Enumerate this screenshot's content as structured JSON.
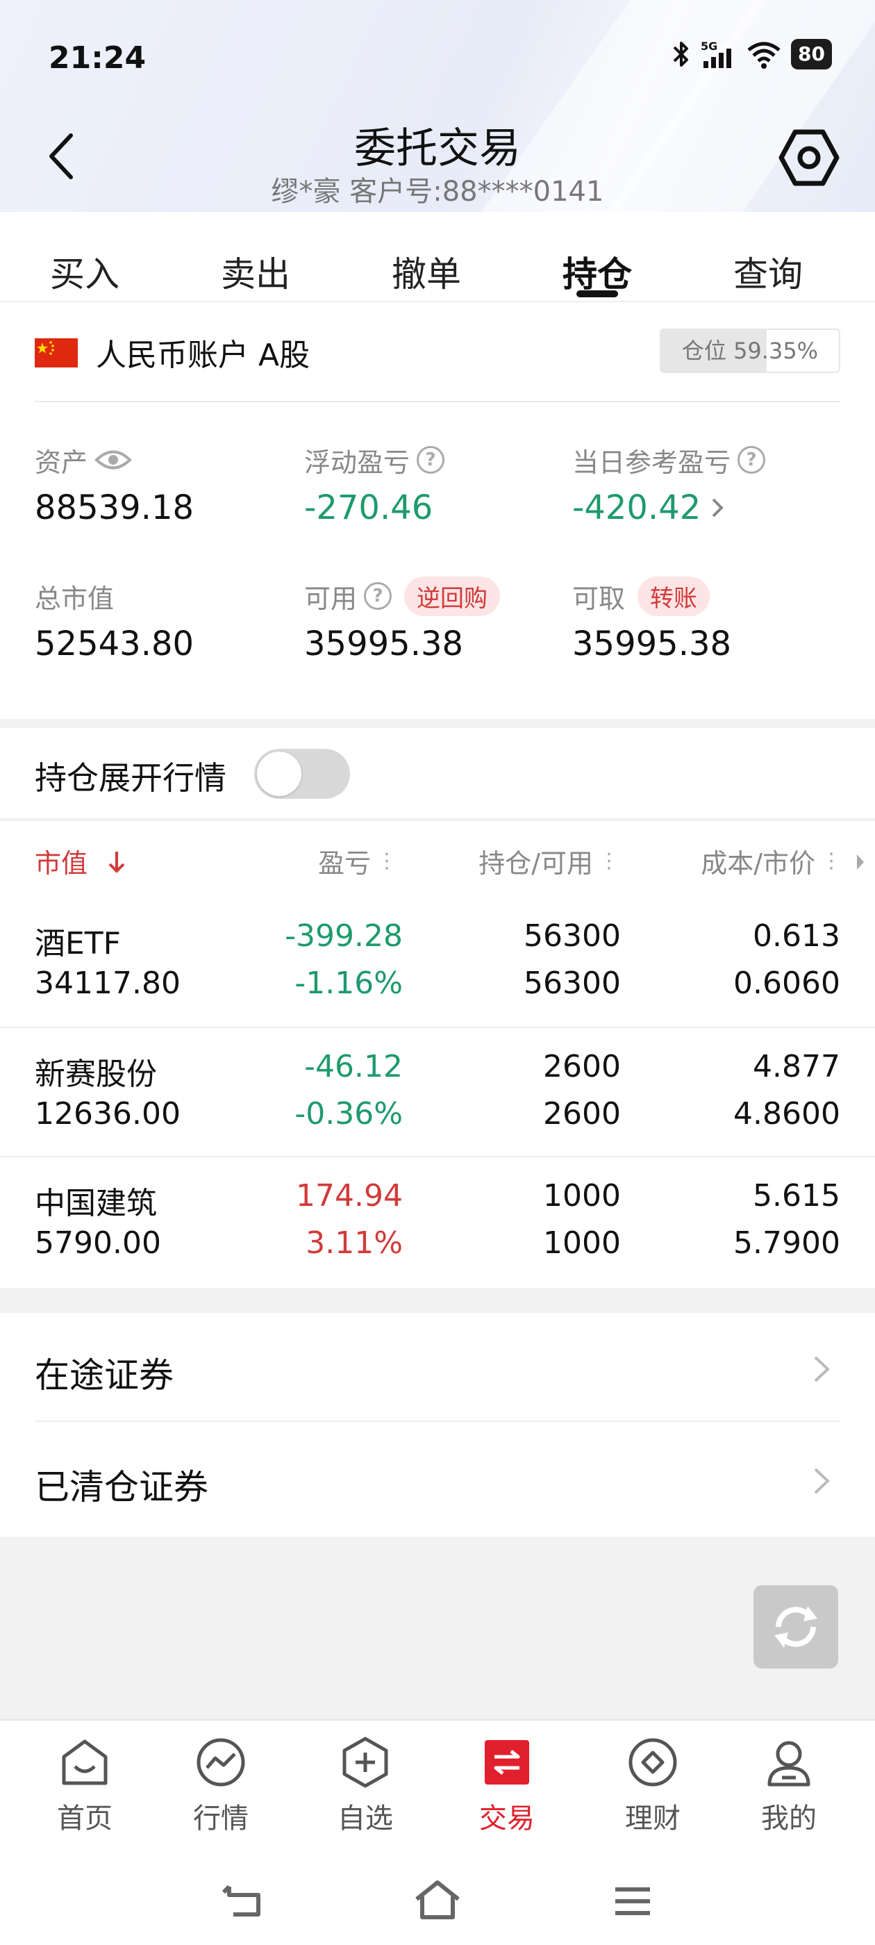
{
  "status_bar": {
    "time": "21:24",
    "battery": "80",
    "network": "5G"
  },
  "header": {
    "title": "委托交易",
    "subtitle": "缪*豪 客户号:88****0141"
  },
  "tabs": [
    {
      "label": "买入",
      "active": false
    },
    {
      "label": "卖出",
      "active": false
    },
    {
      "label": "撤单",
      "active": false
    },
    {
      "label": "持仓",
      "active": true
    },
    {
      "label": "查询",
      "active": false
    }
  ],
  "account": {
    "name": "人民币账户 A股",
    "position_label": "仓位 59.35%",
    "position_ratio": 0.5935
  },
  "metrics": {
    "assets": {
      "label": "资产",
      "value": "88539.18"
    },
    "floating_pl": {
      "label": "浮动盈亏",
      "value": "-270.46"
    },
    "daily_pl": {
      "label": "当日参考盈亏",
      "value": "-420.42"
    },
    "market_value": {
      "label": "总市值",
      "value": "52543.80"
    },
    "available": {
      "label": "可用",
      "value": "35995.38",
      "badge": "逆回购"
    },
    "withdrawable": {
      "label": "可取",
      "value": "35995.38",
      "badge": "转账"
    }
  },
  "toggle": {
    "label": "持仓展开行情",
    "on": false
  },
  "table": {
    "headers": {
      "market_value": "市值",
      "pl": "盈亏",
      "holdings": "持仓/可用",
      "cost": "成本/市价"
    },
    "rows": [
      {
        "name": "酒ETF",
        "market_value": "34117.80",
        "pl": "-399.28",
        "pl_pct": "-1.16%",
        "holding": "56300",
        "available": "56300",
        "cost": "0.613",
        "price": "0.6060",
        "trend": "down"
      },
      {
        "name": "新赛股份",
        "market_value": "12636.00",
        "pl": "-46.12",
        "pl_pct": "-0.36%",
        "holding": "2600",
        "available": "2600",
        "cost": "4.877",
        "price": "4.8600",
        "trend": "down"
      },
      {
        "name": "中国建筑",
        "market_value": "5790.00",
        "pl": "174.94",
        "pl_pct": "3.11%",
        "holding": "1000",
        "available": "1000",
        "cost": "5.615",
        "price": "5.7900",
        "trend": "up"
      }
    ]
  },
  "securities": [
    {
      "label": "在途证券"
    },
    {
      "label": "已清仓证券"
    }
  ],
  "bottom_nav": [
    {
      "label": "首页",
      "icon": "home-icon",
      "active": false
    },
    {
      "label": "行情",
      "icon": "market-icon",
      "active": false
    },
    {
      "label": "自选",
      "icon": "watchlist-icon",
      "active": false
    },
    {
      "label": "交易",
      "icon": "trade-icon",
      "active": true
    },
    {
      "label": "理财",
      "icon": "finance-icon",
      "active": false
    },
    {
      "label": "我的",
      "icon": "profile-icon",
      "active": false
    }
  ],
  "colors": {
    "down_green": "#1e9a6c",
    "up_red": "#d23a3a",
    "active_red": "#e0202c"
  }
}
